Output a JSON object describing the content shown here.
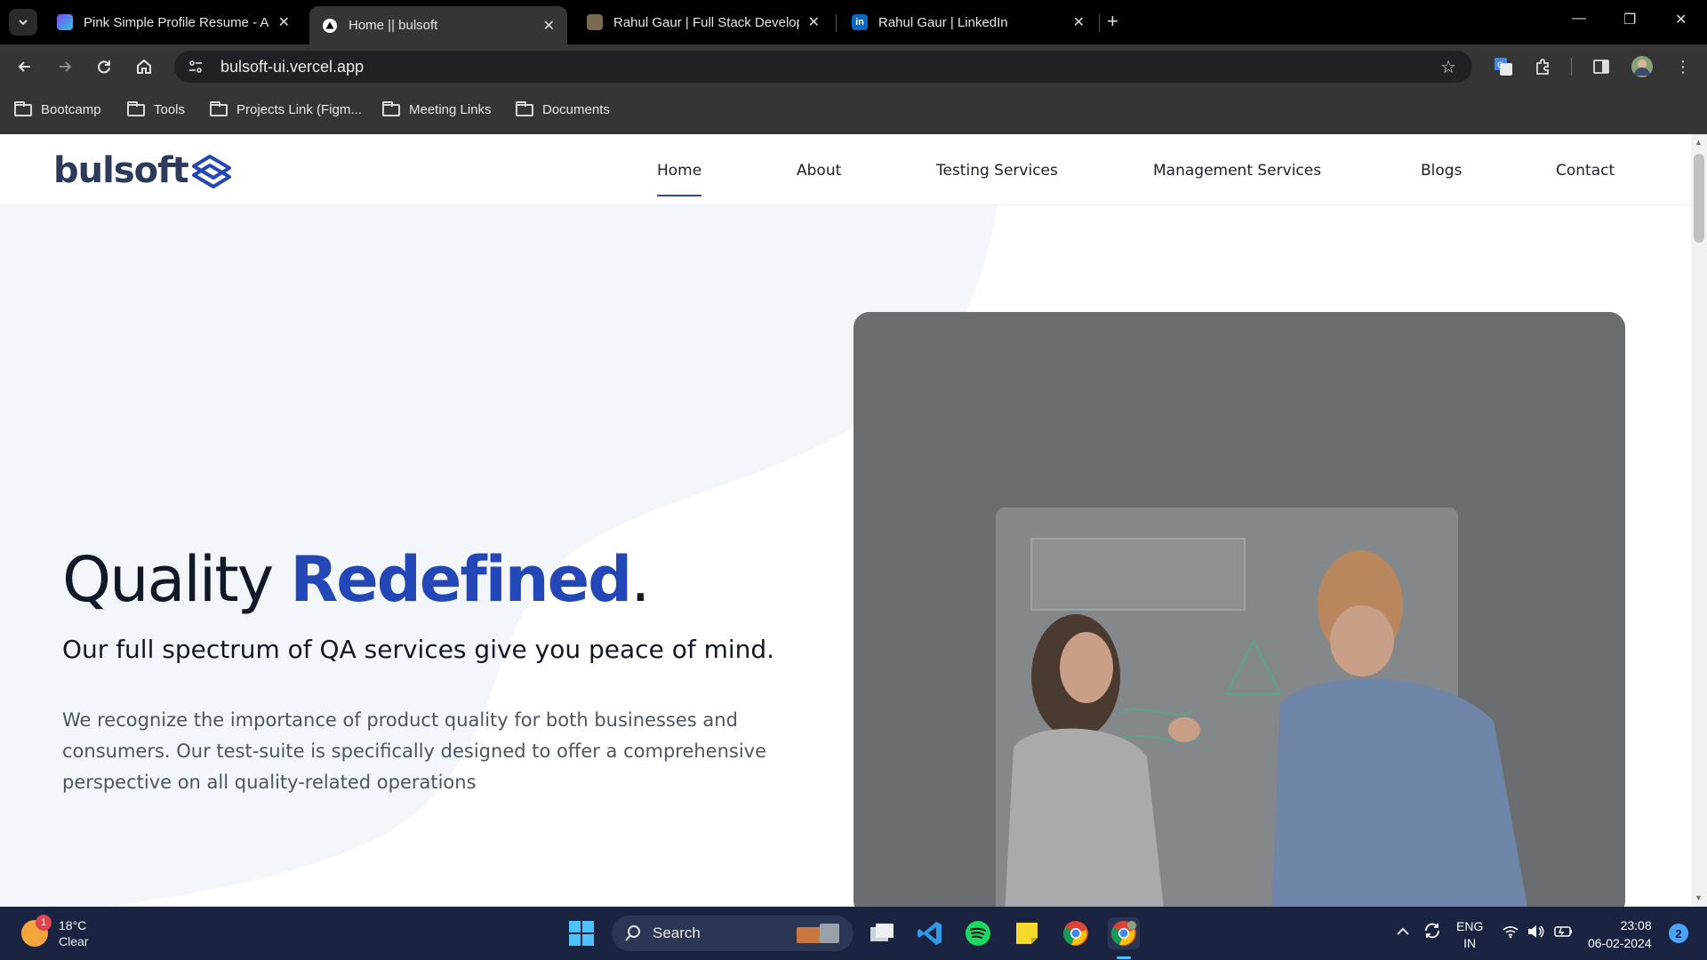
{
  "browser": {
    "tabs": [
      {
        "title": "Pink Simple Profile Resume - A4",
        "active": false,
        "favicon": "canva-icon"
      },
      {
        "title": "Home || bulsoft",
        "active": true,
        "favicon": "vercel-icon"
      },
      {
        "title": "Rahul Gaur | Full Stack Developer",
        "active": false,
        "favicon": "portfolio-photo-icon"
      },
      {
        "title": "Rahul Gaur | LinkedIn",
        "active": false,
        "favicon": "linkedin-icon"
      }
    ],
    "url": "bulsoft-ui.vercel.app",
    "bookmarks": [
      "Bootcamp",
      "Tools",
      "Projects Link (Figm...",
      "Meeting Links",
      "Documents"
    ]
  },
  "site": {
    "logo_text": "bulsoft",
    "nav": [
      "Home",
      "About",
      "Testing Services",
      "Management Services",
      "Blogs",
      "Contact"
    ],
    "active_nav": "Home",
    "hero": {
      "headline_plain": "Quality ",
      "headline_accent": "Redefined",
      "headline_period": ".",
      "subheading": "Our full spectrum of QA services give you peace of mind.",
      "body": "We recognize the importance of product quality for both businesses and consumers. Our test-suite is specifically designed to offer a comprehensive perspective on all quality-related operations"
    },
    "colors": {
      "accent": "#2447b8",
      "hero_bg": "#f3f7fc",
      "text": "#111827"
    }
  },
  "taskbar": {
    "weather_temp": "18°C",
    "weather_condition": "Clear",
    "weather_badge": "1",
    "search_label": "Search",
    "language_line1": "ENG",
    "language_line2": "IN",
    "time": "23:08",
    "date": "06-02-2024",
    "notification_count": "2"
  }
}
